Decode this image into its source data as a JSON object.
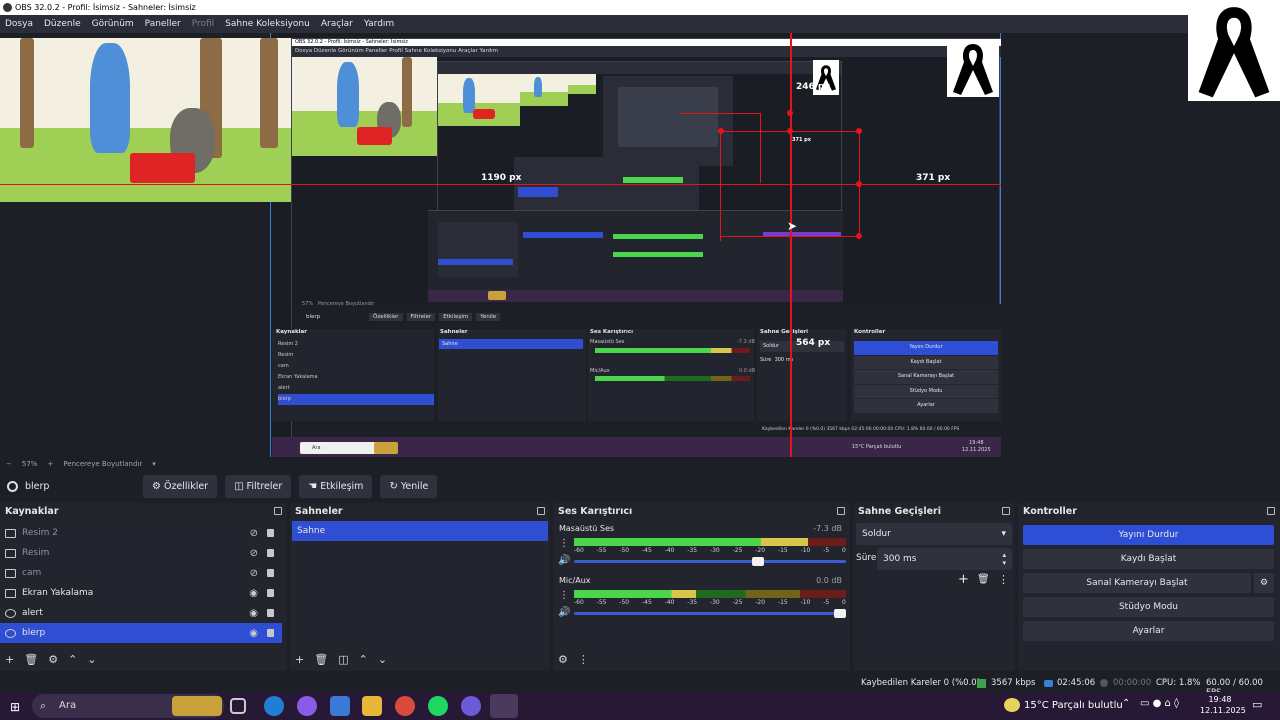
{
  "window": {
    "title": "OBS 32.0.2 - Profil: İsimsiz - Sahneler: İsimsiz"
  },
  "menu": [
    {
      "label": "Dosya"
    },
    {
      "label": "Düzenle"
    },
    {
      "label": "Görünüm"
    },
    {
      "label": "Paneller"
    },
    {
      "label": "Profil"
    },
    {
      "label": "Sahne Koleksiyonu"
    },
    {
      "label": "Araçlar"
    },
    {
      "label": "Yardım"
    }
  ],
  "preview": {
    "measure_top": "246 px",
    "measure_left": "1190 px",
    "measure_right": "371 px",
    "measure_bottom": "564 px",
    "measure_small": "371 px",
    "nested": {
      "menu": "Dosya  Düzenle  Görünüm  Paneller  Profil  Sahne Koleksiyonu  Araçlar  Yardım",
      "title": "OBS 32.0.2 - Profil: İsimsiz - Sahneler: İsimsiz",
      "zoom": "57%",
      "fit": "Pencereye Boyutlandır",
      "selected": "blerp",
      "btn_props": "Özellikler",
      "btn_filters": "Filtreler",
      "btn_interact": "Etkileşim",
      "btn_refresh": "Yenile",
      "sources_title": "Kaynaklar",
      "scenes_title": "Sahneler",
      "mixer_title": "Ses Karıştırıcı",
      "trans_title": "Sahne Geçişleri",
      "controls_title": "Kontroller",
      "sources": [
        "Resim 2",
        "Resim",
        "cam",
        "Ekran Yakalama",
        "alert",
        "blerp"
      ],
      "scene": "Sahne",
      "desktop": "Masaüstü Ses",
      "mic": "Mic/Aux",
      "db1": "-7.3 dB",
      "db2": "0.0 dB",
      "trans": "Soldur",
      "dur_label": "Süre",
      "dur": "300 ms",
      "stop_stream": "Yayını Durdur",
      "record": "Kaydı Başlat",
      "vcam": "Sanal Kamerayı Başlat",
      "studio": "Stüdyo Modu",
      "settings": "Ayarlar",
      "status": "Kaybedilen Kareler 0 (%0.0)    3567 kbps    02:45:06    00:00:00    CPU: 1.8%    60.00 / 60.00 FPS",
      "search": "Ara",
      "weather": "15°C  Parçalı bulutlu",
      "time": "19:48",
      "date": "12.11.2025"
    }
  },
  "zoom": {
    "label": "57%",
    "minus": "−",
    "plus": "+",
    "fit": "Pencereye Boyutlandır"
  },
  "context": {
    "source": "blerp",
    "properties": "Özellikler",
    "filters": "Filtreler",
    "interact": "Etkileşim",
    "refresh": "Yenile"
  },
  "sources": {
    "title": "Kaynaklar",
    "items": [
      {
        "label": "Resim 2",
        "icon": "image-icon",
        "visible": false
      },
      {
        "label": "Resim",
        "icon": "image-icon",
        "visible": false
      },
      {
        "label": "cam",
        "icon": "camera-icon",
        "visible": false
      },
      {
        "label": "Ekran Yakalama",
        "icon": "monitor-icon",
        "visible": true
      },
      {
        "label": "alert",
        "icon": "browser-icon",
        "visible": true
      },
      {
        "label": "blerp",
        "icon": "browser-icon",
        "visible": true
      }
    ]
  },
  "scenes": {
    "title": "Sahneler",
    "items": [
      {
        "label": "Sahne"
      }
    ]
  },
  "mixer": {
    "title": "Ses Karıştırıcı",
    "channels": [
      {
        "name": "Masaüstü Ses",
        "db": "-7.3 dB",
        "level": 0.86,
        "volume": 0.7
      },
      {
        "name": "Mic/Aux",
        "db": "0.0 dB",
        "level": 0.45,
        "volume": 1.0
      }
    ],
    "scale": [
      "-60",
      "-55",
      "-50",
      "-45",
      "-40",
      "-35",
      "-30",
      "-25",
      "-20",
      "-15",
      "-10",
      "-5",
      "0"
    ]
  },
  "transitions": {
    "title": "Sahne Geçişleri",
    "selected": "Soldur",
    "duration_label": "Süre",
    "duration": "300 ms"
  },
  "controls": {
    "title": "Kontroller",
    "stop_stream": "Yayını Durdur",
    "start_record": "Kaydı Başlat",
    "virtual_cam": "Sanal Kamerayı Başlat",
    "studio_mode": "Stüdyo Modu",
    "settings": "Ayarlar"
  },
  "status": {
    "dropped": "Kaybedilen Kareler 0 (%0.0)",
    "bitrate": "3567 kbps",
    "stream_time": "02:45:06",
    "record_time": "00:00:00",
    "cpu": "CPU: 1.8%",
    "fps": "60.00 / 60.00 FPS"
  },
  "taskbar": {
    "search": "Ara",
    "weather": "15°C  Parçalı bulutlu",
    "time": "19:48",
    "date": "12.11.2025"
  },
  "colors": {
    "accent": "#2f4ed1",
    "bg": "#1d1f26",
    "dock": "#23252e",
    "measure": "#e3141a",
    "taskbar": "#271936"
  }
}
